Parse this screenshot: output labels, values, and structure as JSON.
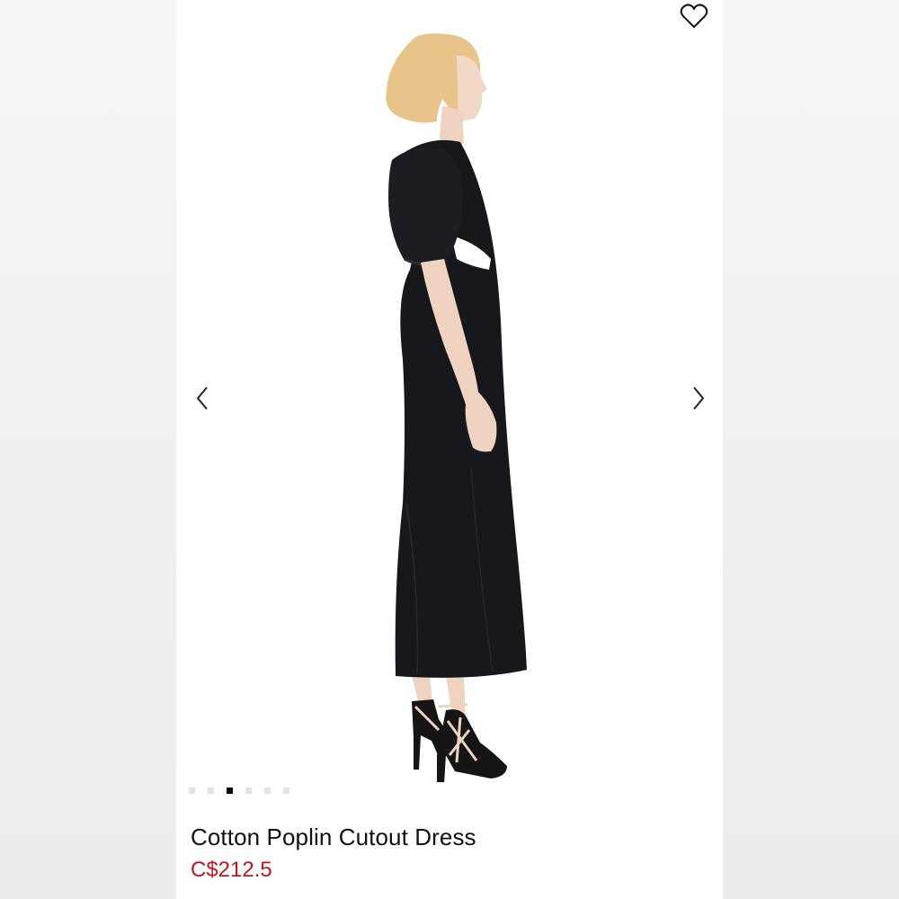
{
  "product": {
    "title": "Cotton Poplin Cutout Dress",
    "price": "C$212.5",
    "price_color": "#c0161c"
  },
  "gallery": {
    "image_count": 6,
    "active_index": 2,
    "prev_icon": "chevron-left-icon",
    "next_icon": "chevron-right-icon",
    "wishlist_icon": "heart-outline-icon"
  },
  "colors": {
    "dress": "#16181c",
    "background": "#ffffff",
    "active_dot": "#000000",
    "inactive_dot": "#e2e2e2"
  }
}
